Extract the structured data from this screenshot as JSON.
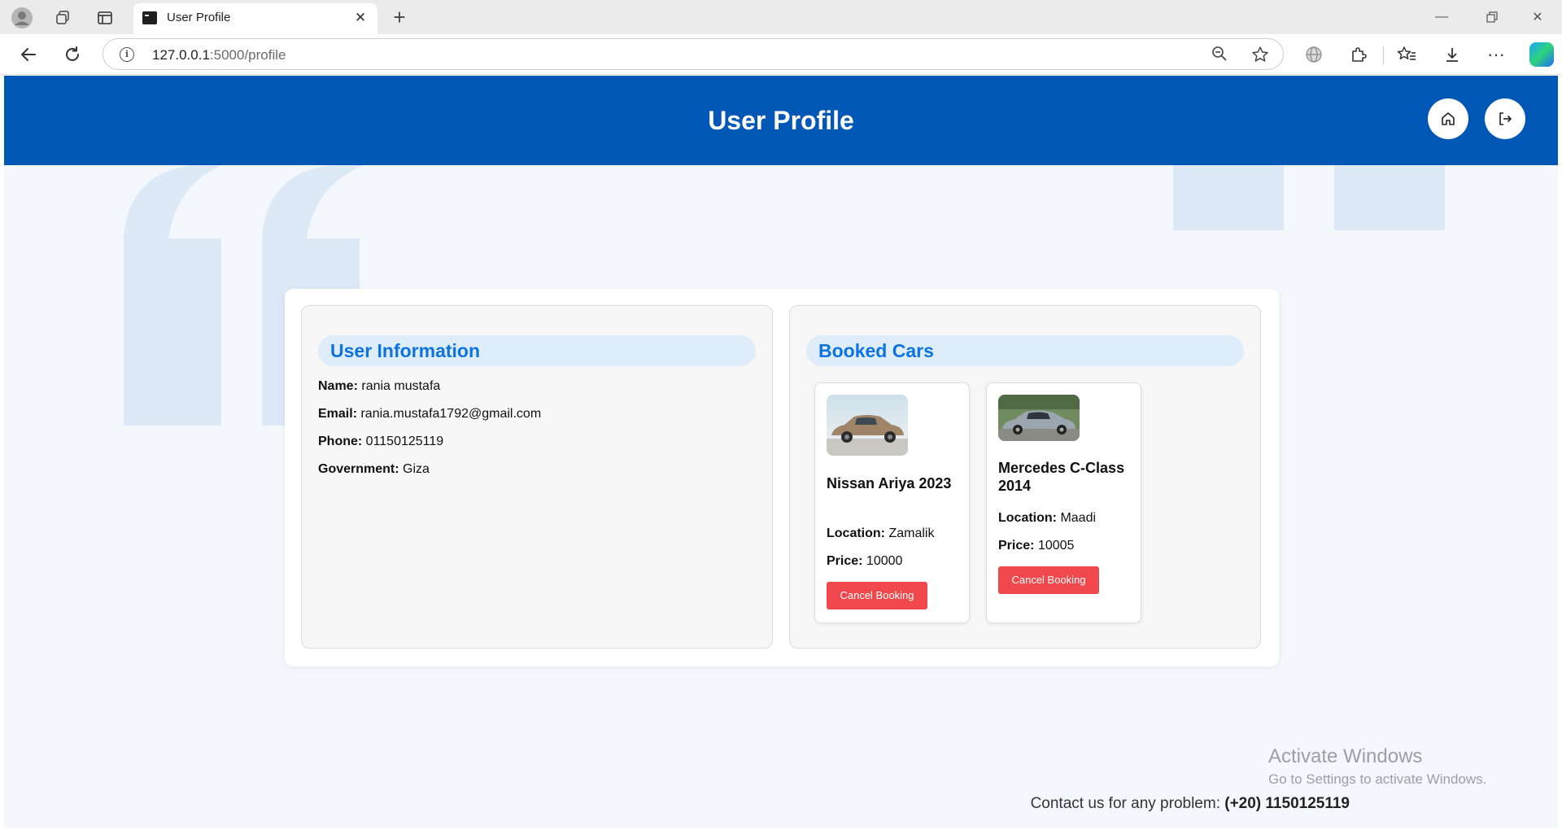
{
  "browser": {
    "tab_title": "User Profile",
    "url_host": "127.0.0.1",
    "url_path": ":5000/profile",
    "icons": [
      "profile-icon",
      "workspaces-icon",
      "vertical-tabs-icon",
      "back-icon",
      "refresh-icon",
      "info-icon",
      "zoom-out-icon",
      "favorite-star-icon",
      "globe-icon",
      "extensions-icon",
      "favorites-icon",
      "download-icon",
      "more-icon",
      "copilot-icon"
    ]
  },
  "header": {
    "title": "User Profile",
    "home_icon": "home-icon",
    "logout_icon": "logout-icon",
    "color": "#0057b5"
  },
  "user_info": {
    "heading": "User Information",
    "name_label": "Name:",
    "name": "rania mustafa",
    "email_label": "Email:",
    "email": "rania.mustafa1792@gmail.com",
    "phone_label": "Phone:",
    "phone": "01150125119",
    "government_label": "Government:",
    "government": "Giza"
  },
  "booked": {
    "heading": "Booked Cars",
    "cars": [
      {
        "name": "Nissan Ariya 2023",
        "location_label": "Location:",
        "location": "Zamalik",
        "price_label": "Price:",
        "price": "10000",
        "cancel_label": "Cancel Booking",
        "image_color": "#a08468"
      },
      {
        "name": "Mercedes C-Class 2014",
        "location_label": "Location:",
        "location": "Maadi",
        "price_label": "Price:",
        "price": "10005",
        "cancel_label": "Cancel Booking",
        "image_color": "#9aa5ae"
      }
    ]
  },
  "watermark": {
    "line1": "Activate Windows",
    "line2": "Go to Settings to activate Windows."
  },
  "footer": {
    "text": "Contact us for any problem:",
    "phone": "(+20) 1150125119"
  },
  "colors": {
    "accent": "#0d73e0",
    "danger": "#f0484c"
  }
}
